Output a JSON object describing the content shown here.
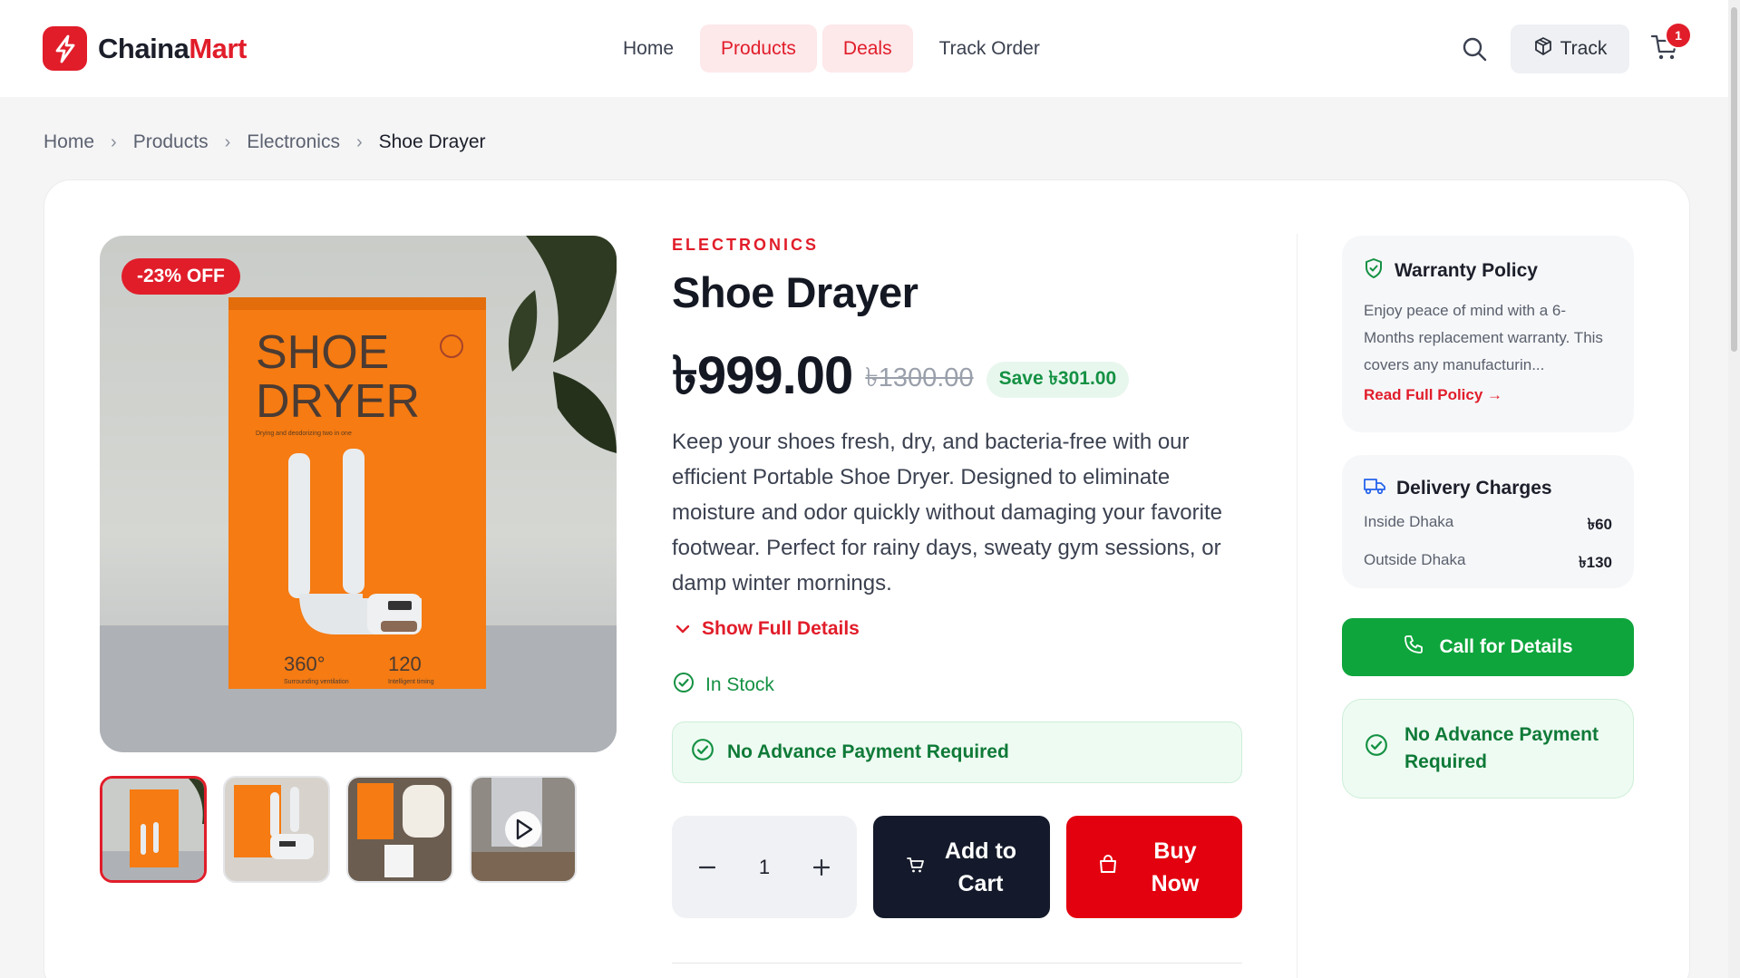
{
  "brand": {
    "name_part1": "Chaina",
    "name_part2": "Mart",
    "color": "#e11d2a"
  },
  "nav": {
    "items": [
      {
        "label": "Home",
        "active": false
      },
      {
        "label": "Products",
        "active": true
      },
      {
        "label": "Deals",
        "active": true
      },
      {
        "label": "Track Order",
        "active": false
      }
    ],
    "search_icon": "search-icon",
    "track_label": "Track",
    "cart_count": "1"
  },
  "breadcrumb": [
    "Home",
    "Products",
    "Electronics",
    "Shoe Drayer"
  ],
  "product": {
    "category": "ELECTRONICS",
    "title": "Shoe Drayer",
    "price": "৳999.00",
    "old_price": "৳1300.00",
    "save_label": "Save ৳301.00",
    "discount_badge": "-23% OFF",
    "description": "Keep your shoes fresh, dry, and bacteria-free with our efficient Portable Shoe Dryer. Designed to eliminate moisture and odor quickly without damaging your favorite footwear. Perfect for rainy days, sweaty gym sessions, or damp winter mornings.",
    "show_details_label": "Show Full Details",
    "stock_label": "In Stock",
    "no_advance_label": "No Advance Payment Required",
    "image": {
      "box_title_line1": "SHOE",
      "box_title_line2": "DRYER",
      "box_subtitle": "Drying and deodorizing two in one",
      "feature1_value": "360°",
      "feature1_label": "Surrounding ventilation",
      "feature2_value": "120",
      "feature2_label": "Intelligent timing"
    },
    "thumbnails": [
      "Shoe dryer box",
      "Shoe dryer with device",
      "Box and device with manual",
      "Video preview"
    ],
    "quantity": "1",
    "add_to_cart_label": "Add to Cart",
    "buy_now_label": "Buy Now"
  },
  "sidebar": {
    "warranty": {
      "title": "Warranty Policy",
      "text": "Enjoy peace of mind with a 6-Months replacement warranty. This covers any manufacturin...",
      "link": "Read Full Policy →"
    },
    "delivery": {
      "title": "Delivery Charges",
      "rows": [
        {
          "label": "Inside Dhaka",
          "amount": "৳60"
        },
        {
          "label": "Outside Dhaka",
          "amount": "৳130"
        }
      ]
    },
    "call_label": "Call for Details",
    "no_advance_label": "No Advance Payment Required"
  },
  "colors": {
    "accent": "#e11d2a",
    "success": "#149143",
    "call_button": "#0ea53c",
    "dark_button": "#141a2b"
  }
}
